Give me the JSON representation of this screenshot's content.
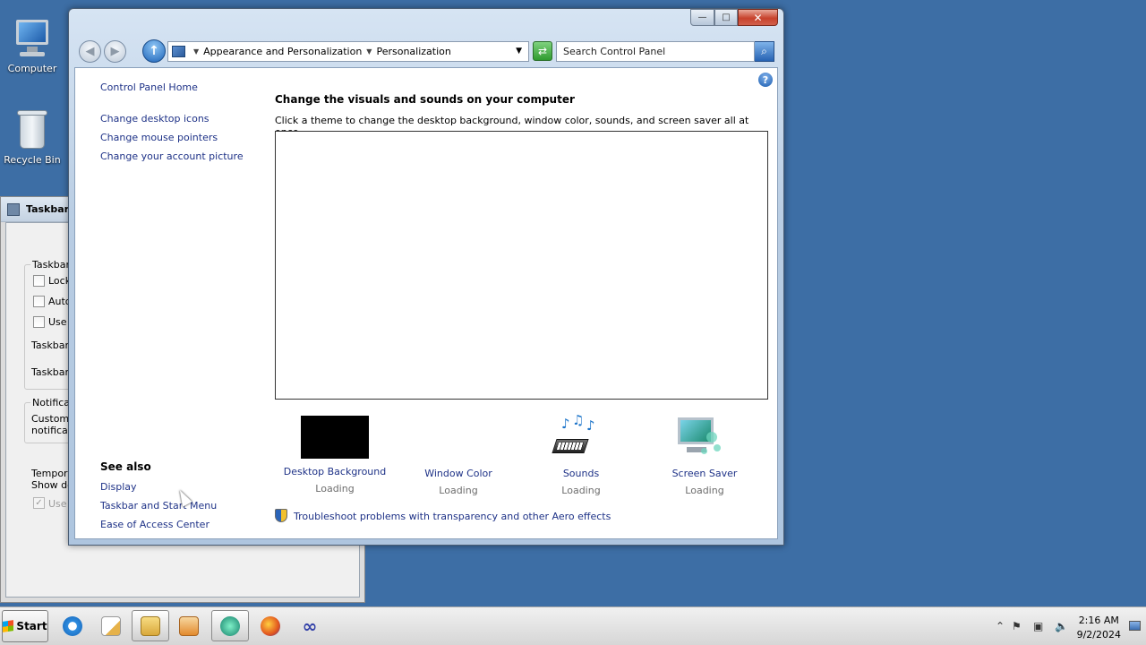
{
  "desktop": {
    "icons": [
      {
        "label": "Computer"
      },
      {
        "label": "Recycle Bin"
      }
    ]
  },
  "background_window": {
    "title": "Taskbar ar",
    "group1_label": "Taskbar a",
    "check_lock": "Lock",
    "check_autohide": "Auto-",
    "check_small": "Use s",
    "row_location": "Taskbar c",
    "row_buttons": "Taskbar :",
    "group2_label": "Notificati",
    "customize_1": "Customize",
    "customize_2": "notificati",
    "aero_1": "Tempora",
    "aero_2": "Show des",
    "use_aero": "Use A"
  },
  "window": {
    "caption": {
      "minimize": "—",
      "maximize": "□",
      "close": "✕"
    },
    "address": {
      "crumb1": "Appearance and Personalization",
      "crumb2": "Personalization"
    },
    "search_placeholder": "Search Control Panel",
    "sidebar": {
      "home": "Control Panel Home",
      "links": [
        "Change desktop icons",
        "Change mouse pointers",
        "Change your account picture"
      ],
      "see_also_title": "See also",
      "see_also": [
        "Display",
        "Taskbar and Start Menu",
        "Ease of Access Center"
      ]
    },
    "main": {
      "heading": "Change the visuals and sounds on your computer",
      "subtext": "Click a theme to change the desktop background, window color, sounds, and screen saver all at once.",
      "tiles": [
        {
          "label": "Desktop Background",
          "state": "Loading"
        },
        {
          "label": "Window Color",
          "state": "Loading"
        },
        {
          "label": "Sounds",
          "state": "Loading"
        },
        {
          "label": "Screen Saver",
          "state": "Loading"
        }
      ],
      "troubleshoot": "Troubleshoot problems with transparency and other Aero effects"
    }
  },
  "taskbar": {
    "start_label": "Start",
    "clock_time": "2:16 AM",
    "clock_date": "9/2/2024"
  }
}
